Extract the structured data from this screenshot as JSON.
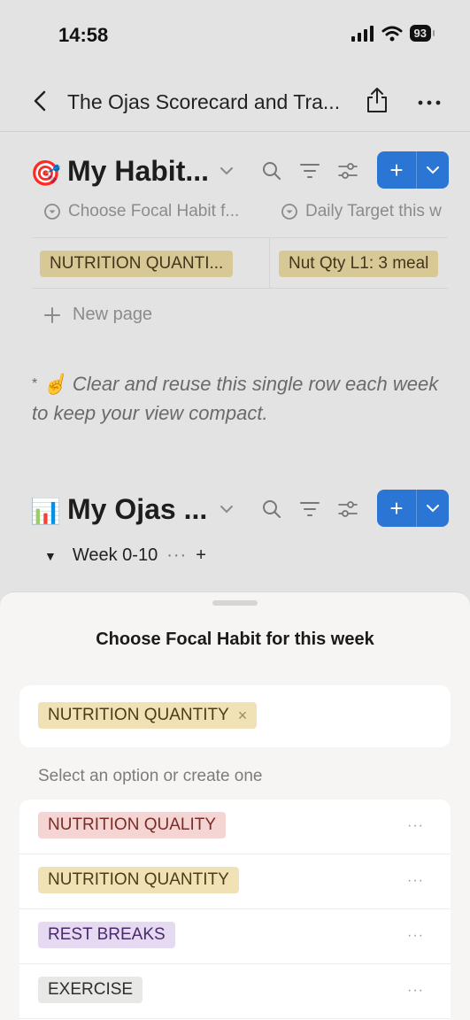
{
  "status_bar": {
    "time": "14:58",
    "battery": "93"
  },
  "nav": {
    "title": "The Ojas Scorecard and Tra..."
  },
  "focal_db": {
    "emoji": "🎯",
    "title": "My Habit...",
    "columns": [
      {
        "label": "Choose Focal Habit f..."
      },
      {
        "label": "Daily Target this w"
      }
    ],
    "row": {
      "focal_habit": "NUTRITION QUANTI...",
      "daily_target": "Nut Qty L1: 3 meal"
    },
    "new_page_label": "New page"
  },
  "note": {
    "asterisk": "*",
    "emoji": "☝️",
    "text": "Clear and reuse this single row each week to keep your view compact."
  },
  "scores_db": {
    "emoji": "📊",
    "title": "My Ojas ...",
    "group": {
      "label": "Week 0-10",
      "more": "···",
      "add": "+"
    }
  },
  "sheet": {
    "title": "Choose Focal Habit for this week",
    "selected": {
      "label": "NUTRITION QUANTITY",
      "remove": "×"
    },
    "helper": "Select an option or create one",
    "options": [
      {
        "label": "NUTRITION QUALITY",
        "color": "red",
        "more": "···"
      },
      {
        "label": "NUTRITION QUANTITY",
        "color": "yellow",
        "more": "···"
      },
      {
        "label": "REST BREAKS",
        "color": "purple",
        "more": "···"
      },
      {
        "label": "EXERCISE",
        "color": "gray",
        "more": "···"
      }
    ]
  },
  "colors": {
    "accent": "#2b76d4",
    "background": "#e3e3e3",
    "sheet": "#f6f5f3"
  }
}
